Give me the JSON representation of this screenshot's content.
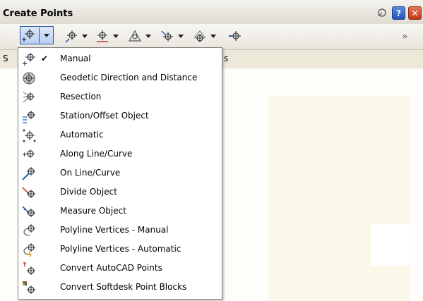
{
  "window": {
    "title": "Create Points",
    "help_label": "?",
    "close_label": "✕"
  },
  "toolbar": {
    "tools": [
      {
        "icon": "point-manual-icon"
      },
      {
        "icon": "point-along-line-icon"
      },
      {
        "icon": "point-intersection-icon"
      },
      {
        "icon": "point-alignment-icon"
      },
      {
        "icon": "point-surface-icon"
      },
      {
        "icon": "point-interpolate-icon"
      },
      {
        "icon": "point-slope-icon"
      }
    ],
    "expand_label": "»"
  },
  "strip": {
    "left_text": "S",
    "right_text": "s"
  },
  "menu": {
    "items": [
      {
        "label": "Manual",
        "checked": true,
        "icon": "point-manual-icon"
      },
      {
        "label": "Geodetic Direction and Distance",
        "checked": false,
        "icon": "geodetic-icon"
      },
      {
        "label": "Resection",
        "checked": false,
        "icon": "resection-icon"
      },
      {
        "label": "Station/Offset Object",
        "checked": false,
        "icon": "station-offset-icon"
      },
      {
        "label": "Automatic",
        "checked": false,
        "icon": "automatic-icon"
      },
      {
        "label": "Along Line/Curve",
        "checked": false,
        "icon": "along-line-curve-icon"
      },
      {
        "label": "On Line/Curve",
        "checked": false,
        "icon": "on-line-curve-icon"
      },
      {
        "label": "Divide Object",
        "checked": false,
        "icon": "divide-object-icon"
      },
      {
        "label": "Measure Object",
        "checked": false,
        "icon": "measure-object-icon"
      },
      {
        "label": "Polyline Vertices - Manual",
        "checked": false,
        "icon": "polyline-manual-icon"
      },
      {
        "label": "Polyline Vertices - Automatic",
        "checked": false,
        "icon": "polyline-automatic-icon"
      },
      {
        "label": "Convert AutoCAD Points",
        "checked": false,
        "icon": "convert-autocad-icon"
      },
      {
        "label": "Convert Softdesk Point Blocks",
        "checked": false,
        "icon": "convert-softdesk-icon"
      }
    ],
    "check_glyph": "✔"
  }
}
